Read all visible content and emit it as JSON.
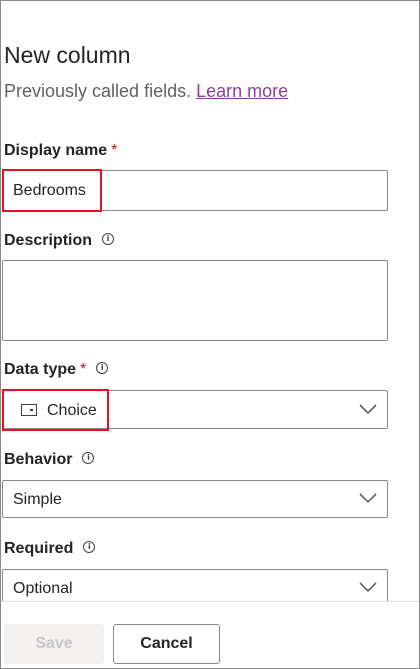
{
  "panel": {
    "title": "New column",
    "subtitle": "Previously called fields.",
    "learn_more": "Learn more"
  },
  "fields": {
    "display_name": {
      "label": "Display name",
      "required_mark": "*",
      "value": "Bedrooms"
    },
    "description": {
      "label": "Description",
      "value": ""
    },
    "data_type": {
      "label": "Data type",
      "required_mark": "*",
      "value": "Choice",
      "icon": "choice-icon"
    },
    "behavior": {
      "label": "Behavior",
      "value": "Simple"
    },
    "required": {
      "label": "Required",
      "value": "Optional"
    }
  },
  "footer": {
    "save_label": "Save",
    "cancel_label": "Cancel"
  },
  "colors": {
    "highlight": "#e81123",
    "required_star": "#c50f1f",
    "link": "#8a3fa0"
  }
}
